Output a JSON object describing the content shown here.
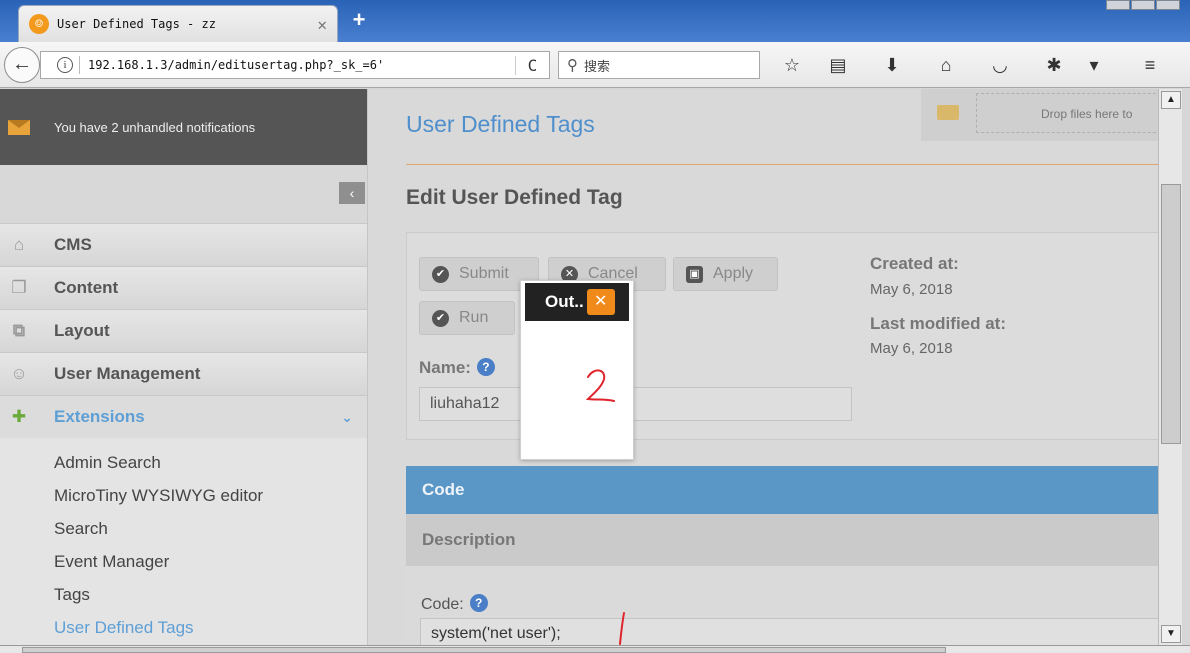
{
  "browser": {
    "tab_title": "User Defined Tags - zz",
    "tab_close": "✕",
    "new_tab": "+",
    "url": "192.168.1.3/admin/editusertag.php?_sk_=6'",
    "search_placeholder": "搜索",
    "info_glyph": "i",
    "reload_glyph": "C"
  },
  "sidebar": {
    "notification": "You have 2 unhandled notifications",
    "collapse_glyph": "‹",
    "menu": [
      {
        "label": "CMS",
        "icon": "home-icon"
      },
      {
        "label": "Content",
        "icon": "pages-icon"
      },
      {
        "label": "Layout",
        "icon": "layout-icon"
      },
      {
        "label": "User Management",
        "icon": "users-icon"
      },
      {
        "label": "Extensions",
        "icon": "puzzle-icon"
      }
    ],
    "submenu": [
      "Admin Search",
      "MicroTiny WYSIWYG editor",
      "Search",
      "Event Manager",
      "Tags",
      "User Defined Tags"
    ]
  },
  "main": {
    "page_title": "User Defined Tags",
    "dropzone_text": "Drop files here to",
    "edit_heading": "Edit User Defined Tag",
    "buttons": {
      "submit": "Submit",
      "cancel": "Cancel",
      "apply": "Apply",
      "run": "Run"
    },
    "created_label": "Created at:",
    "created_value": "May 6, 2018",
    "modified_label": "Last modified at:",
    "modified_value": "May 6, 2018",
    "name_label": "Name:",
    "name_value": "liuhaha12",
    "code_tab": "Code",
    "description_tab": "Description",
    "code_label": "Code:",
    "code_value": "system('net user');"
  },
  "popup": {
    "title": "Out..",
    "close_glyph": "✕"
  },
  "colors": {
    "accent_blue": "#4f8fcc",
    "code_bar": "#5a96c6",
    "orange": "#f08a1a",
    "annotation_red": "#e0242c"
  }
}
